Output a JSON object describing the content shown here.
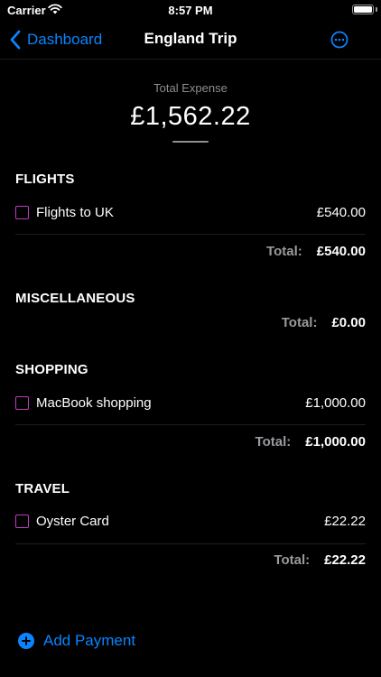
{
  "status_bar": {
    "carrier": "Carrier",
    "time": "8:57 PM"
  },
  "nav": {
    "back_label": "Dashboard",
    "title": "England Trip"
  },
  "summary": {
    "label": "Total Expense",
    "amount": "£1,562.22"
  },
  "total_label": "Total:",
  "sections": [
    {
      "title": "FLIGHTS",
      "items": [
        {
          "name": "Flights to UK",
          "amount": "£540.00"
        }
      ],
      "total": "£540.00"
    },
    {
      "title": "MISCELLANEOUS",
      "items": [],
      "total": "£0.00"
    },
    {
      "title": "SHOPPING",
      "items": [
        {
          "name": "MacBook shopping",
          "amount": "£1,000.00"
        }
      ],
      "total": "£1,000.00"
    },
    {
      "title": "TRAVEL",
      "items": [
        {
          "name": "Oyster Card",
          "amount": "£22.22"
        }
      ],
      "total": "£22.22"
    }
  ],
  "add_payment": {
    "label": "Add Payment"
  },
  "colors": {
    "accent": "#0a84ff",
    "checkbox": "#c239c5",
    "background": "#000000"
  }
}
